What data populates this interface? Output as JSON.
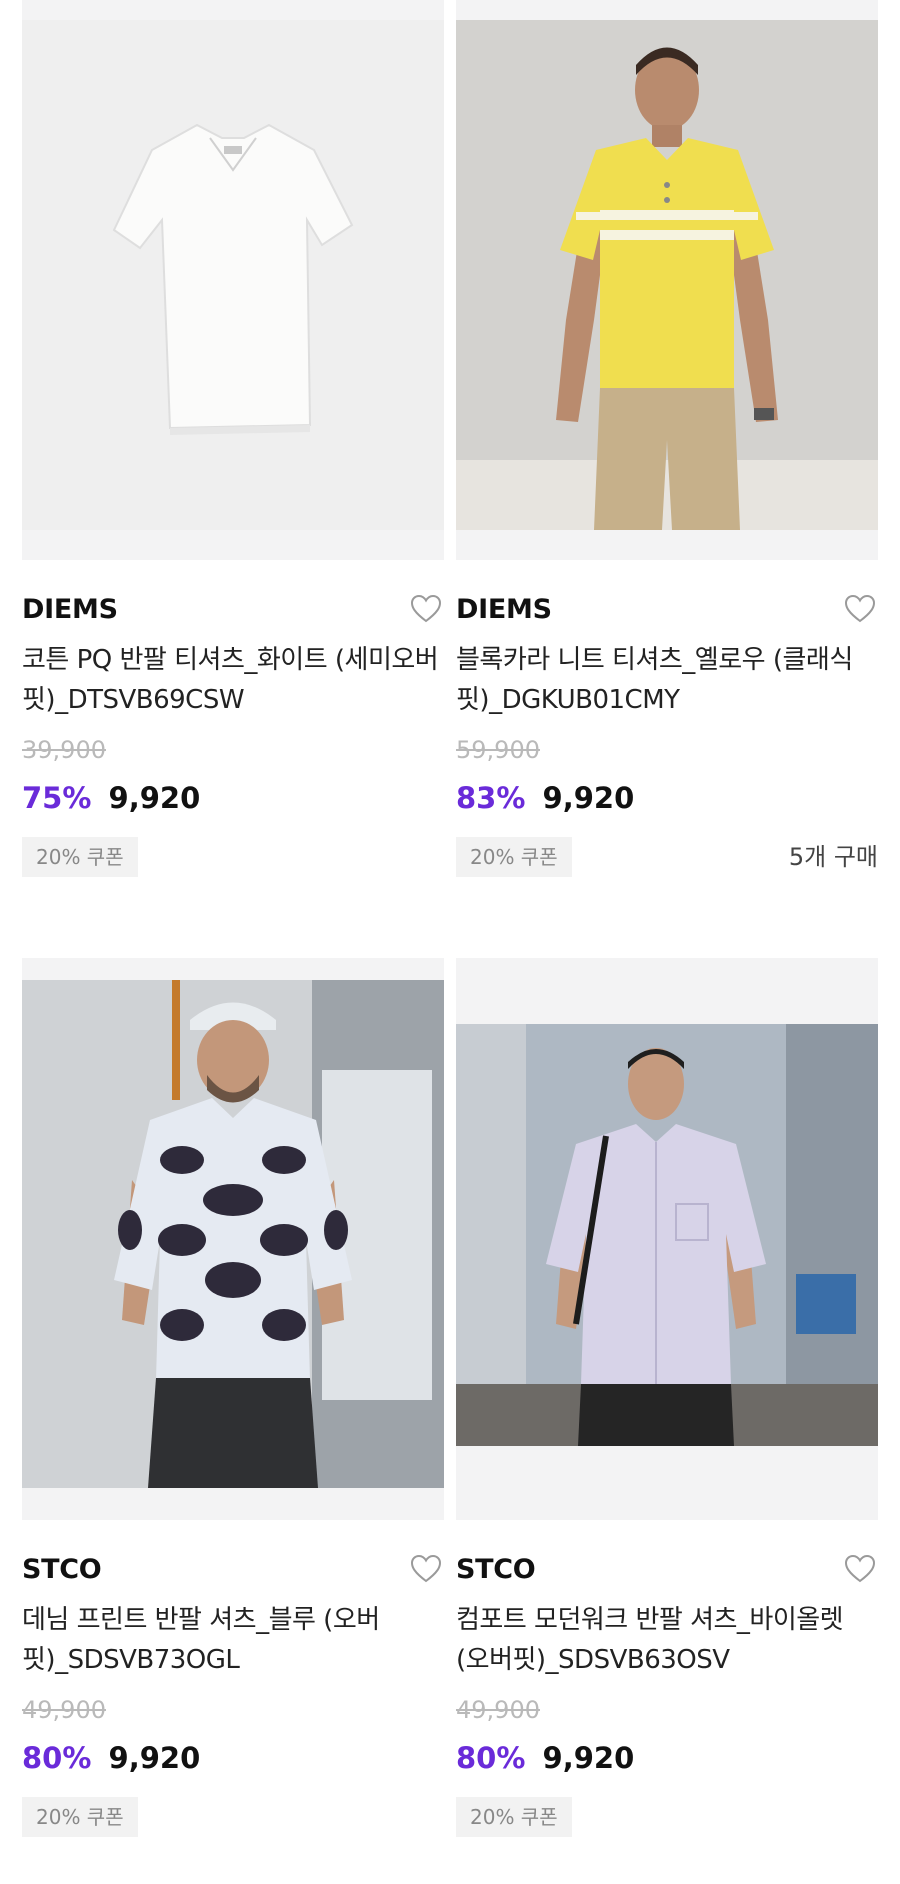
{
  "products": [
    {
      "brand": "DIEMS",
      "name": "코튼 PQ 반팔 티셔츠_화이트 (세미오버핏)_DTSVB69CSW",
      "original_price": "39,900",
      "discount": "75%",
      "price": "9,920",
      "coupon": "20% 쿠폰",
      "purchases": ""
    },
    {
      "brand": "DIEMS",
      "name": "블록카라 니트 티셔츠_옐로우 (클래식핏)_DGKUB01CMY",
      "original_price": "59,900",
      "discount": "83%",
      "price": "9,920",
      "coupon": "20% 쿠폰",
      "purchases": "5개 구매"
    },
    {
      "brand": "STCO",
      "name": "데님 프린트 반팔 셔츠_블루 (오버핏)_SDSVB73OGL",
      "original_price": "49,900",
      "discount": "80%",
      "price": "9,920",
      "coupon": "20% 쿠폰",
      "purchases": ""
    },
    {
      "brand": "STCO",
      "name": "컴포트 모던워크 반팔 셔츠_바이올렛 (오버핏)_SDSVB63OSV",
      "original_price": "49,900",
      "discount": "80%",
      "price": "9,920",
      "coupon": "20% 쿠폰",
      "purchases": ""
    }
  ],
  "icons": {
    "wishlist": "heart-outline-icon"
  },
  "colors": {
    "discount": "#6a2bd9",
    "coupon_bg": "#f2f2f2",
    "thumb_bg": "#f3f3f4"
  }
}
